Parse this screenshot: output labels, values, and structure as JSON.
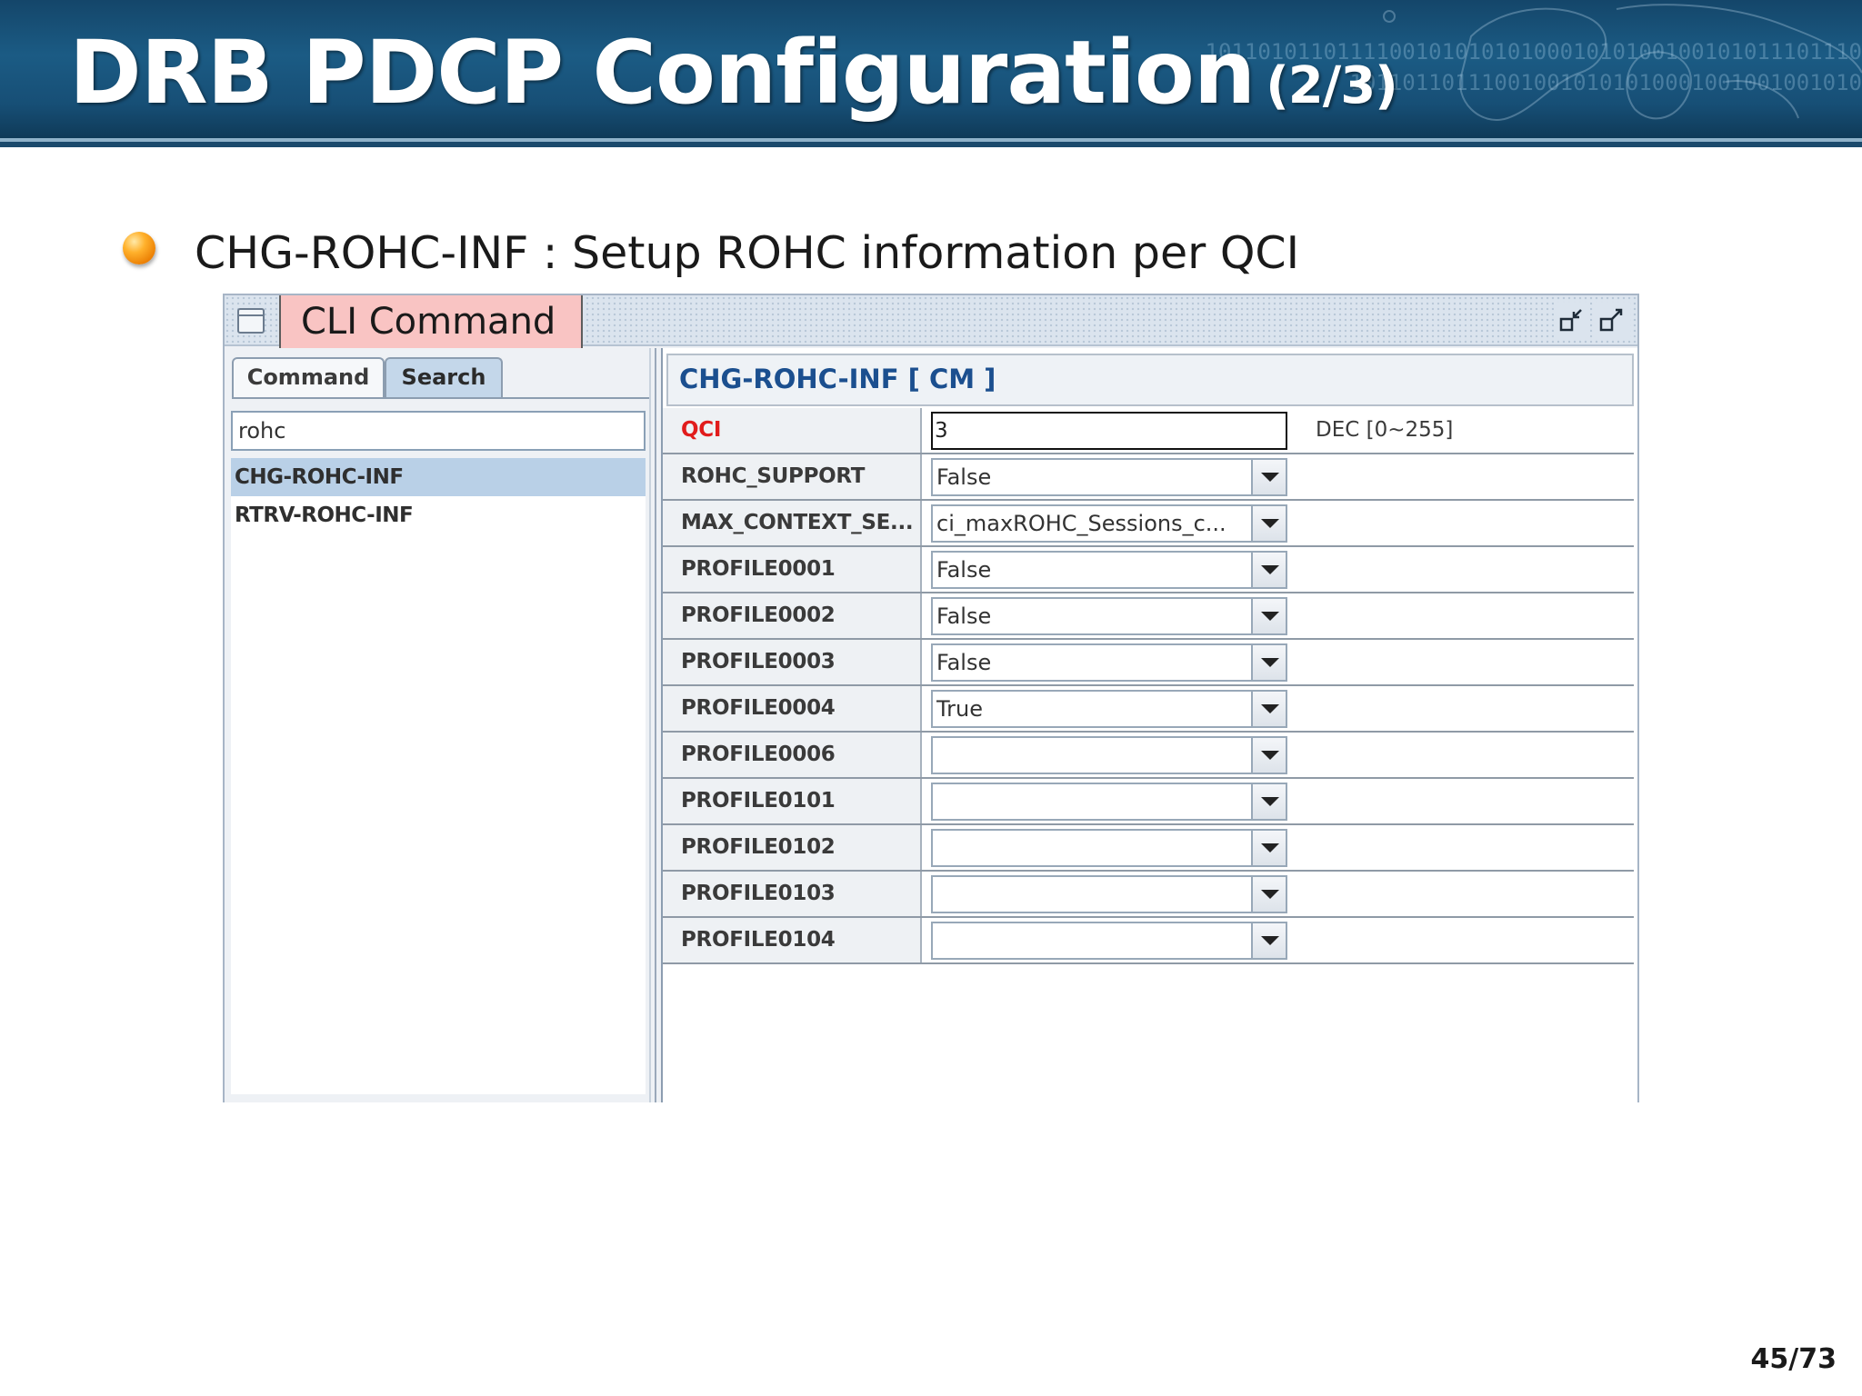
{
  "slide": {
    "title": "DRB PDCP Configuration",
    "title_suffix": "(2/3)",
    "decoration_binary_1": "10110101101111001010101010001010100100101011101110",
    "decoration_binary_2": "101101101110010010101010001001001001010",
    "bullet": "CHG-ROHC-INF : Setup ROHC information per QCI",
    "page_number": "45/73",
    "colors": {
      "header_dark": "#14466a",
      "required_label": "#e11c1c",
      "selection": "#b9d0e7",
      "callout": "#f9c4c3"
    }
  },
  "window": {
    "callout_label": "CLI Command",
    "tabs": [
      {
        "label": "Command",
        "selected": false
      },
      {
        "label": "Search",
        "selected": true
      }
    ],
    "search_value": "rohc",
    "results": [
      {
        "label": "CHG-ROHC-INF",
        "selected": true
      },
      {
        "label": "RTRV-ROHC-INF",
        "selected": false
      }
    ],
    "form": {
      "header": "CHG-ROHC-INF [ CM ]",
      "rows": [
        {
          "label": "QCI",
          "value": "3",
          "range": "DEC [0~255]"
        },
        {
          "label": "ROHC_SUPPORT",
          "value": "False"
        },
        {
          "label": "MAX_CONTEXT_SE...",
          "value": "ci_maxROHC_Sessions_c..."
        },
        {
          "label": "PROFILE0001",
          "value": "False"
        },
        {
          "label": "PROFILE0002",
          "value": "False"
        },
        {
          "label": "PROFILE0003",
          "value": "False"
        },
        {
          "label": "PROFILE0004",
          "value": "True"
        },
        {
          "label": "PROFILE0006",
          "value": ""
        },
        {
          "label": "PROFILE0101",
          "value": ""
        },
        {
          "label": "PROFILE0102",
          "value": ""
        },
        {
          "label": "PROFILE0103",
          "value": ""
        },
        {
          "label": "PROFILE0104",
          "value": ""
        }
      ]
    }
  }
}
